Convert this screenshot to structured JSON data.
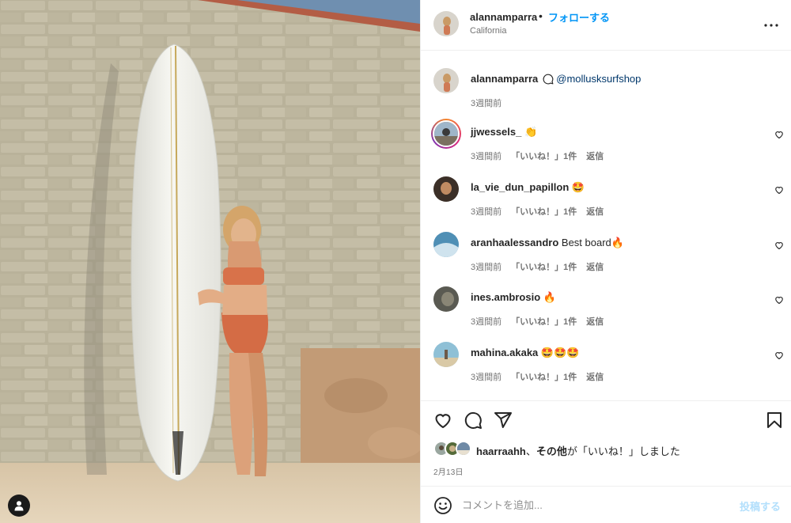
{
  "post": {
    "username": "alannamparra",
    "separator": "•",
    "follow_label": "フォローする",
    "location": "California"
  },
  "caption": {
    "username": "alannamparra",
    "mention": "@mollusksurfshop",
    "time": "3週間前"
  },
  "comments": [
    {
      "username": "jjwessels_",
      "text": "👏",
      "time": "3週間前",
      "likes": "「いいね！」1件",
      "reply": "返信"
    },
    {
      "username": "la_vie_dun_papillon",
      "text": "🤩",
      "time": "3週間前",
      "likes": "「いいね！」1件",
      "reply": "返信"
    },
    {
      "username": "aranhaalessandro",
      "text": "Best board🔥",
      "time": "3週間前",
      "likes": "「いいね！」1件",
      "reply": "返信"
    },
    {
      "username": "ines.ambrosio",
      "text": "🔥",
      "time": "3週間前",
      "likes": "「いいね！」1件",
      "reply": "返信"
    },
    {
      "username": "mahina.akaka",
      "text": "🤩🤩🤩",
      "time": "3週間前",
      "likes": "「いいね！」1件",
      "reply": "返信"
    }
  ],
  "liked_by": {
    "first_user": "haarraahh",
    "separator": "、",
    "others": "その他",
    "suffix": "が「いいね！」しました"
  },
  "date": "2月13日",
  "add_comment": {
    "placeholder": "コメントを追加...",
    "post_label": "投稿する"
  },
  "colors": {
    "accent": "#0095f6",
    "post_disabled": "#b2dffc",
    "muted": "#737373",
    "mention": "#00376b"
  },
  "icons": {
    "more": "more-horizontal-icon",
    "comment_like": "heart-outline-icon",
    "like": "heart-icon",
    "comment": "comment-icon",
    "share": "paper-plane-icon",
    "save": "bookmark-icon",
    "emoji": "smiley-icon",
    "tagged": "user-tag-icon",
    "caption": "speech-bubble-icon"
  }
}
